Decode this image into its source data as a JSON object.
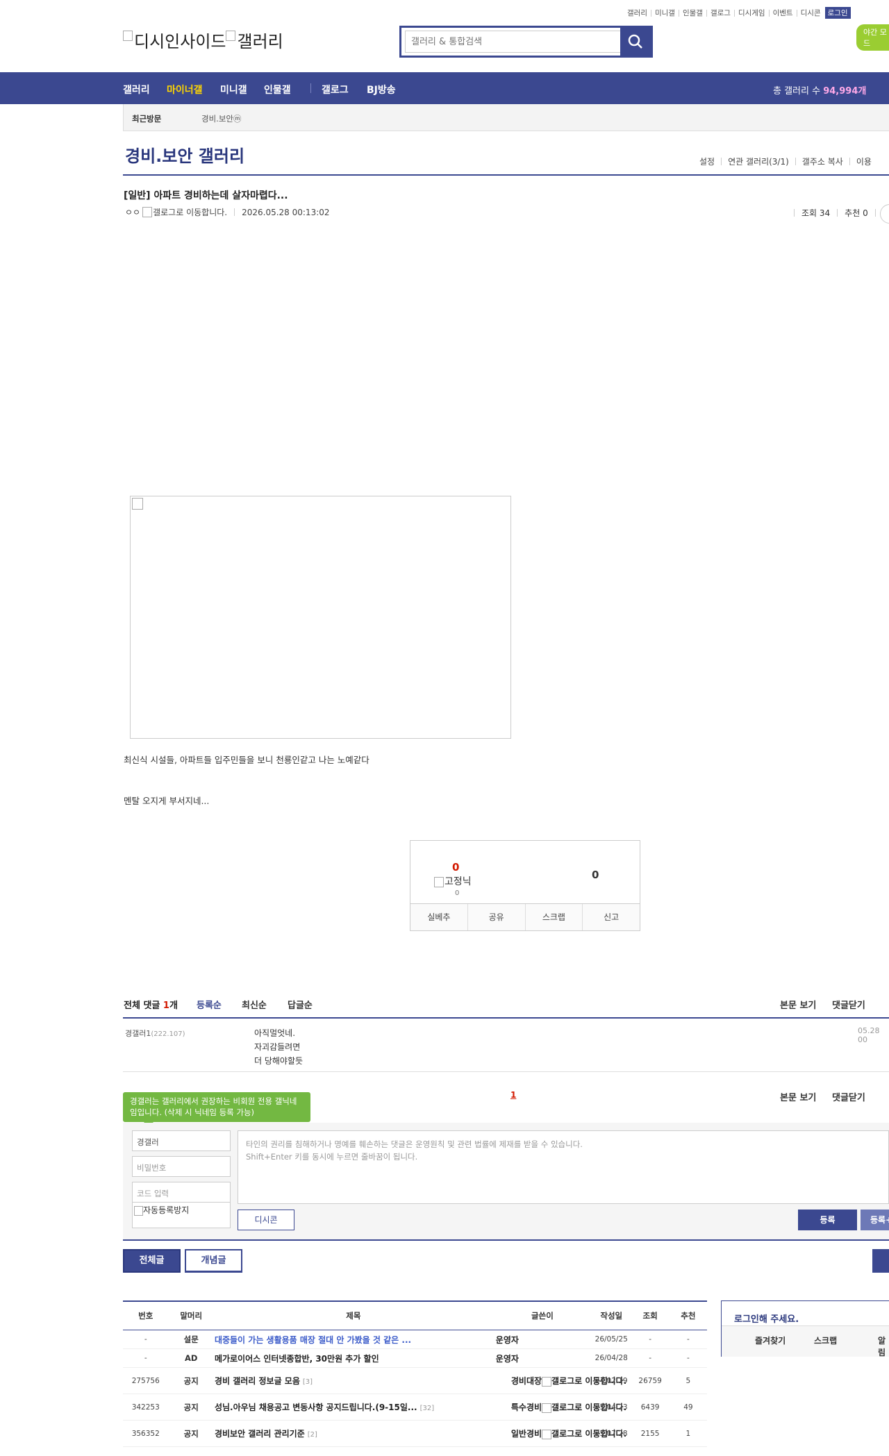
{
  "util_menu": [
    "갤러리",
    "미니갤",
    "인물갤",
    "갤로그",
    "디시게임",
    "이벤트",
    "디시콘"
  ],
  "login_label": "로그인",
  "night_mode_label": "야간 모드",
  "logo_text": "디시인사이드",
  "logo_sub": "갤러리",
  "search": {
    "placeholder": "갤러리 & 통합검색"
  },
  "nav": {
    "items": [
      "갤러리",
      "마이너갤",
      "미니갤",
      "인물갤",
      "갤로그",
      "BJ방송"
    ],
    "total_label": "총 갤러리 수",
    "total_value": "94,994개"
  },
  "recent": {
    "label": "최근방문",
    "gallery": "경비.보안ⓜ"
  },
  "gallery": {
    "title": "경비.보안 갤러리",
    "menu": [
      "설정",
      "연관 갤러리(3/1)",
      "갤주소 복사",
      "이용"
    ]
  },
  "post": {
    "title": "[일반] 아파트 경비하는데 살자마렵다...",
    "author": "ㅇㅇ",
    "gallog_alt": "갤로그로 이동합니다.",
    "date": "2026.05.28 00:13:02",
    "views": "조회 34",
    "recommend": "추천 0",
    "body": [
      "최신식 시설들, 아파트들 입주민들을 보니 천룡인같고 나는 노예같다",
      "멘탈 오지게 부서지네..."
    ]
  },
  "vote": {
    "up": "0",
    "fixed_label": "고정닉",
    "fixed_count": "0",
    "down": "0",
    "buttons": [
      "실베추",
      "공유",
      "스크랩",
      "신고"
    ]
  },
  "comments": {
    "total_label": "전체 댓글",
    "total_count": "1",
    "total_unit": "개",
    "sorts": [
      "등록순",
      "최신순",
      "답글순"
    ],
    "view_body": "본문 보기",
    "close": "댓글닫기",
    "items": [
      {
        "nick": "경갤러1",
        "ip": "(222.107)",
        "lines": [
          "아직멀엇네.",
          "자괴감들려면",
          "더 당해야할듯"
        ],
        "date": "05.28 00"
      }
    ],
    "page": "1"
  },
  "write": {
    "tooltip": "경갤러는 갤러리에서 권장하는 비회원 전용 갤닉네임입니다. (삭제 시 닉네임 등록 가능)",
    "nick_value": "경갤러",
    "pw_placeholder": "비밀번호",
    "code_placeholder": "코드 입력",
    "captcha_alt": "자동등록방지",
    "textarea_placeholder": [
      "타인의 권리를 침해하거나 명예를 훼손하는 댓글은 운영원칙 및 관련 법률에 제재를 받을 수 있습니다.",
      "Shift+Enter 키를 동시에 누르면 줄바꿈이 됩니다."
    ],
    "dccon": "디시콘",
    "submit": "등록",
    "submit2": "등록+"
  },
  "list_buttons": {
    "all": "전체글",
    "concept": "개념글"
  },
  "table": {
    "headers": [
      "번호",
      "말머리",
      "제목",
      "글쓴이",
      "작성일",
      "조회",
      "추천"
    ],
    "rows": [
      {
        "no": "-",
        "head": "설문",
        "subject": "대중들이 가는 생활용품 매장 절대 안 가봤을 것 같은 ...",
        "cnt": "",
        "writer": "운영자",
        "gallog": false,
        "date": "26/05/25",
        "views": "-",
        "rec": "-",
        "blue": true
      },
      {
        "no": "-",
        "head": "AD",
        "subject": "메가로이어스 인터넷종합반, 30만원 추가 할인",
        "cnt": "",
        "writer": "운영자",
        "gallog": false,
        "date": "26/04/28",
        "views": "-",
        "rec": "-",
        "blue": false
      },
      {
        "no": "275756",
        "head": "공지",
        "subject": "경비 갤러리 정보글 모음",
        "cnt": "[3]",
        "writer": "경비대장",
        "gallog": true,
        "date": "24.02.19",
        "views": "26759",
        "rec": "5",
        "blue": false
      },
      {
        "no": "342253",
        "head": "공지",
        "subject": "성님.아우님 채용공고 변동사항 공지드립니다.(9-15일...",
        "cnt": "[32]",
        "writer": "특수경비",
        "gallog": true,
        "date": "25.04.23",
        "views": "6439",
        "rec": "49",
        "blue": false
      },
      {
        "no": "356352",
        "head": "공지",
        "subject": "경비보안 갤러리 관리기준",
        "cnt": "[2]",
        "writer": "일반경비",
        "gallog": true,
        "date": "25.07.28",
        "views": "2155",
        "rec": "1",
        "blue": false
      }
    ],
    "gallog_label": "갤로그로 이동합니다."
  },
  "side": {
    "title": "로그인해 주세요.",
    "links": [
      "즐겨찾기",
      "스크랩",
      "알림"
    ]
  }
}
